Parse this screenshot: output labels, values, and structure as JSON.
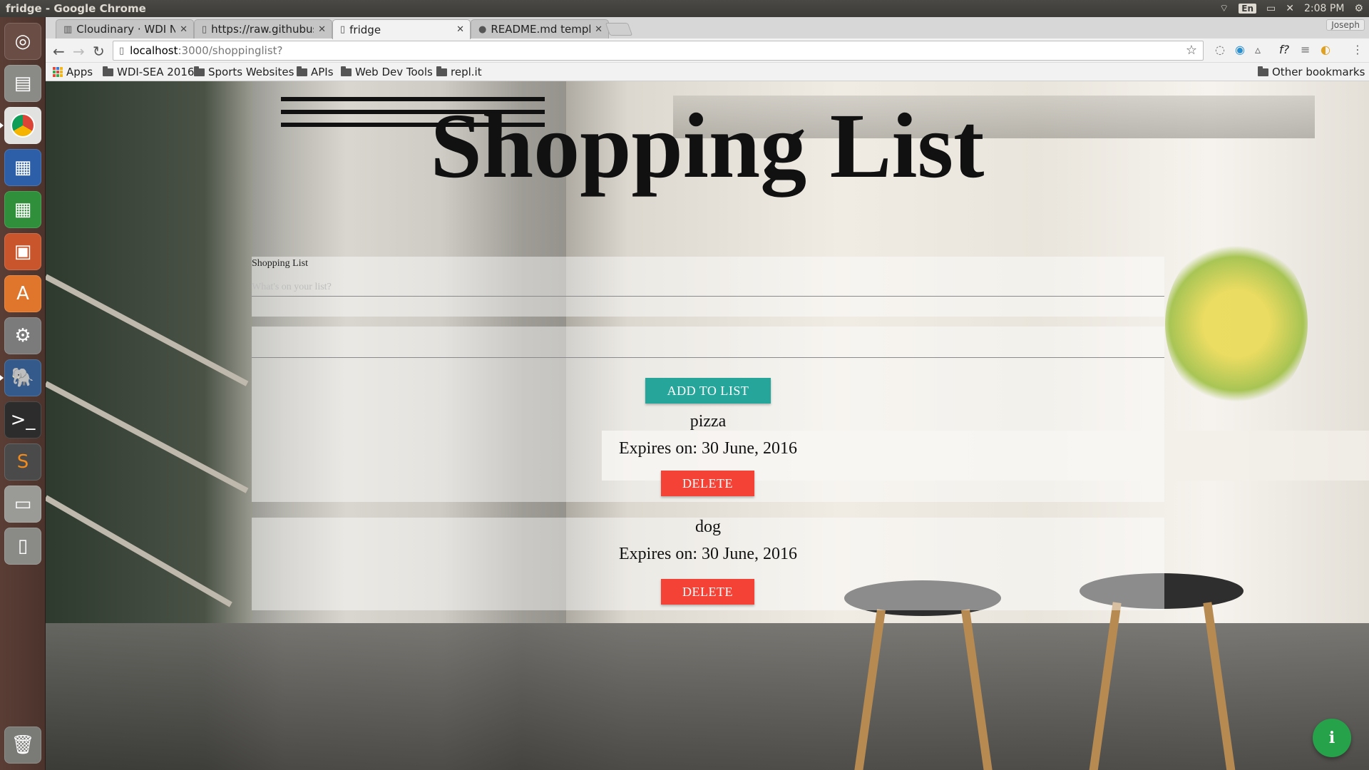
{
  "os": {
    "window_title": "fridge - Google Chrome",
    "keyboard_lang": "En",
    "clock": "2:08 PM"
  },
  "browser": {
    "profile_name": "Joseph",
    "tabs": [
      {
        "title": "Cloudinary · WDI Notes",
        "icon": "book-icon"
      },
      {
        "title": "https://raw.githubusercontent",
        "icon": "page-icon"
      },
      {
        "title": "fridge",
        "icon": "page-icon",
        "active": true
      },
      {
        "title": "README.md template",
        "icon": "github-icon"
      }
    ],
    "url_host": "localhost",
    "url_path": ":3000/shoppinglist?",
    "bookmarks": [
      "Apps",
      "WDI-SEA 2016",
      "Sports Websites",
      "APIs",
      "Web Dev Tools",
      "repl.it"
    ],
    "other_bookmarks": "Other bookmarks"
  },
  "app": {
    "title": "Shopping List",
    "form": {
      "label": "Shopping List",
      "item_placeholder": "What's on your list?",
      "add_button": "ADD TO LIST"
    },
    "items": [
      {
        "name": "pizza",
        "expires": "Expires on: 30 June, 2016",
        "delete_label": "DELETE"
      },
      {
        "name": "dog",
        "expires": "Expires on: 30 June, 2016",
        "delete_label": "DELETE"
      }
    ],
    "fab_icon": "info-icon",
    "accent_color": "#26a69a",
    "danger_color": "#f44336"
  }
}
